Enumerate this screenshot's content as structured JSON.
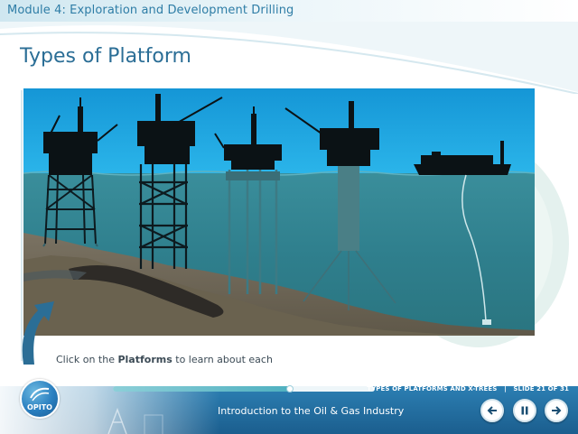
{
  "module": {
    "title": "Module 4: Exploration and Development Drilling"
  },
  "page": {
    "title": "Types of Platform"
  },
  "instruction": {
    "prefix": "Click on the ",
    "emphasis": "Platforms",
    "suffix": " to learn about each"
  },
  "footer": {
    "section": "TYPES OF PLATFORMS AND X-TREES",
    "separator": "|",
    "slide": "SLIDE 21 OF 31",
    "course_title": "Introduction to the Oil & Gas Industry",
    "progress_fraction": 0.677
  },
  "logo": {
    "text": "OPITO"
  },
  "buttons": {
    "back_icon": "arrow-left-icon",
    "pause_icon": "pause-icon",
    "next_icon": "arrow-right-icon"
  },
  "colors": {
    "accent": "#2b6e96",
    "sky": "#1aa3e0",
    "sea": "#2f8391",
    "footer": "#1f6a9d"
  }
}
